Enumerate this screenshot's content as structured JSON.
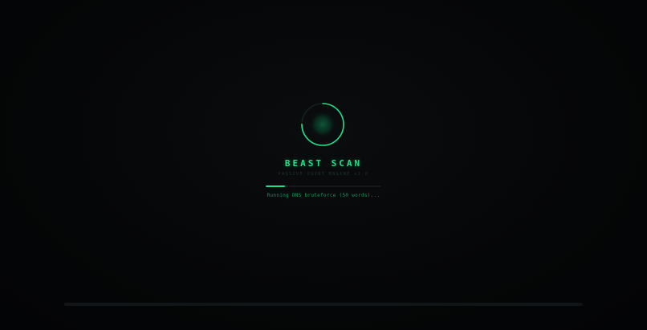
{
  "loader": {
    "title": "BEAST SCAN",
    "subtitle": "PASSIVE OSINT ENGINE v2.0",
    "status": "Running DNS bruteforce (50 words)...",
    "progress": 0.17,
    "spinner_progress": 0.75
  },
  "colors": {
    "accent": "#1fe08a",
    "background": "#050607",
    "track": "#14191c"
  },
  "icons": {
    "spinner": "radar-spinner-icon"
  }
}
